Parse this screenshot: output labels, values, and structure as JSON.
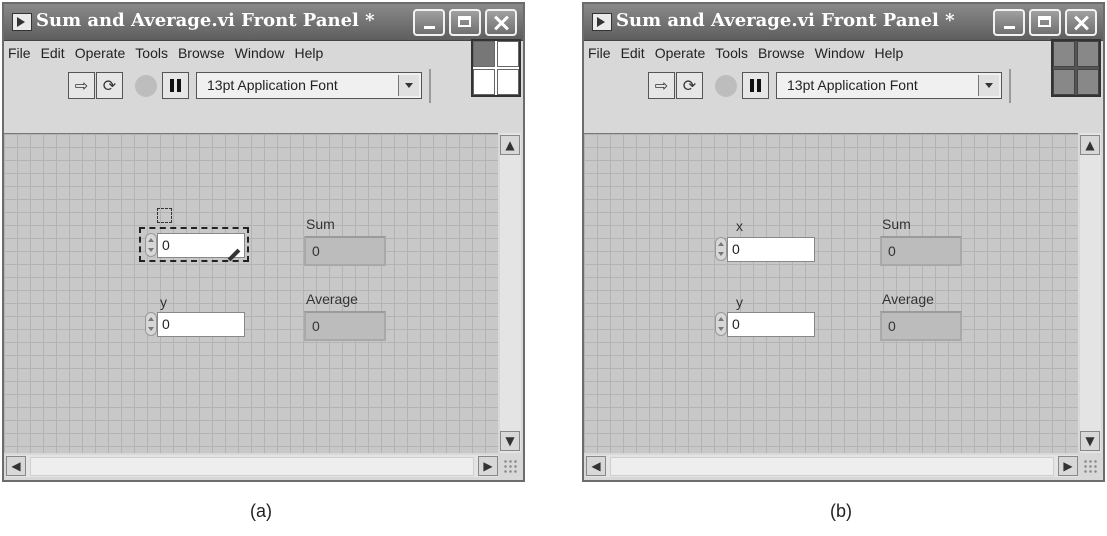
{
  "windows": [
    {
      "title": "Sum and Average.vi Front Panel *",
      "menu": [
        "File",
        "Edit",
        "Operate",
        "Tools",
        "Browse",
        "Window",
        "Help"
      ],
      "font_selector": "13pt Application Font",
      "controls": {
        "x_label": "",
        "x_value": "0",
        "y_label": "y",
        "y_value": "0",
        "sum_label": "Sum",
        "sum_value": "0",
        "average_label": "Average",
        "average_value": "0"
      },
      "caption": "(a)"
    },
    {
      "title": "Sum and Average.vi Front Panel *",
      "menu": [
        "File",
        "Edit",
        "Operate",
        "Tools",
        "Browse",
        "Window",
        "Help"
      ],
      "font_selector": "13pt Application Font",
      "controls": {
        "x_label": "x",
        "x_value": "0",
        "y_label": "y",
        "y_value": "0",
        "sum_label": "Sum",
        "sum_value": "0",
        "average_label": "Average",
        "average_value": "0"
      },
      "caption": "(b)"
    }
  ],
  "icons": [
    "labview-vi-icon",
    "minimize-icon",
    "maximize-icon",
    "close-icon",
    "run-arrow-icon",
    "run-continuously-icon",
    "abort-icon",
    "pause-icon",
    "connector-pane-icon",
    "scroll-up-icon",
    "scroll-down-icon",
    "scroll-left-icon",
    "scroll-right-icon",
    "resize-grip-icon"
  ],
  "colors": {
    "title_bar": "#6e6e6e",
    "panel_grid": "#c8c8c8",
    "indicator_bg": "#bcbcbc"
  }
}
